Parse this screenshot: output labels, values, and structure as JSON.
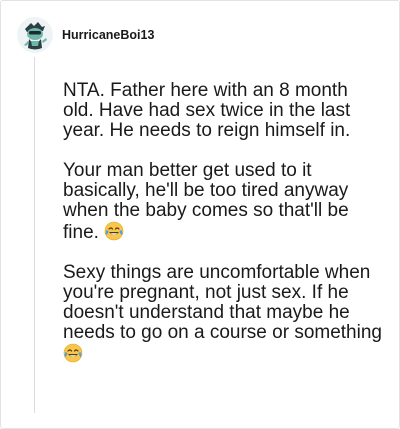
{
  "comment": {
    "username": "HurricaneBoi13",
    "avatar_icon": "reddit-snoo-avatar-icon",
    "paragraphs": [
      {
        "text": "NTA. Father here with an 8 month old. Have had sex twice in the last year. He needs to reign himself in.",
        "emoji": ""
      },
      {
        "text": "Your man better get used to it basically, he'll be too tired anyway when the baby comes so that'll be fine.",
        "emoji": "tears-of-joy-emoji"
      },
      {
        "text": "Sexy things are uncomfortable when you're pregnant, not just sex. If he doesn't understand that maybe he needs to go on a course or something",
        "emoji": "tears-of-joy-emoji"
      }
    ]
  },
  "colors": {
    "text": "#1a1a1a",
    "border": "#e3e3e3",
    "thread_line": "#dcdcdc",
    "emoji_face": "#f7c64a",
    "emoji_tears": "#4aa3e6"
  }
}
